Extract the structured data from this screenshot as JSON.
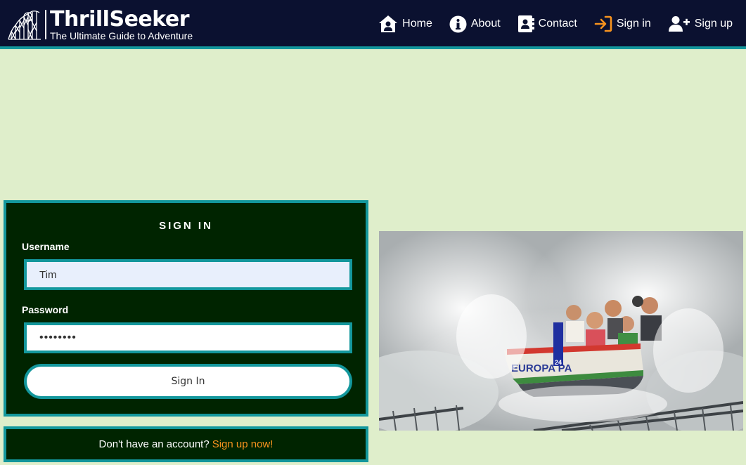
{
  "brand": {
    "title": "ThrillSeeker",
    "tagline": "The Ultimate Guide to Adventure"
  },
  "nav": {
    "items": [
      {
        "label": "Home",
        "icon": "home-user-icon"
      },
      {
        "label": "About",
        "icon": "info-circle-icon"
      },
      {
        "label": "Contact",
        "icon": "address-book-icon"
      },
      {
        "label": "Sign in",
        "icon": "sign-in-arrow-icon"
      },
      {
        "label": "Sign up",
        "icon": "user-plus-icon"
      }
    ]
  },
  "signin": {
    "title": "SIGN IN",
    "username_label": "Username",
    "username_value": "Tim",
    "password_label": "Password",
    "password_value": "passwor8",
    "button_label": "Sign In"
  },
  "signup": {
    "prompt": "Don't have an account?",
    "link_label": "Sign up now!"
  },
  "photo": {
    "boat_text": "EUROPA PA",
    "boat_number": "24"
  },
  "colors": {
    "nav_bg": "#0b1130",
    "accent_teal": "#13979c",
    "page_bg": "#dfeecb",
    "card_bg": "#002400",
    "link_orange": "#f7931e"
  }
}
